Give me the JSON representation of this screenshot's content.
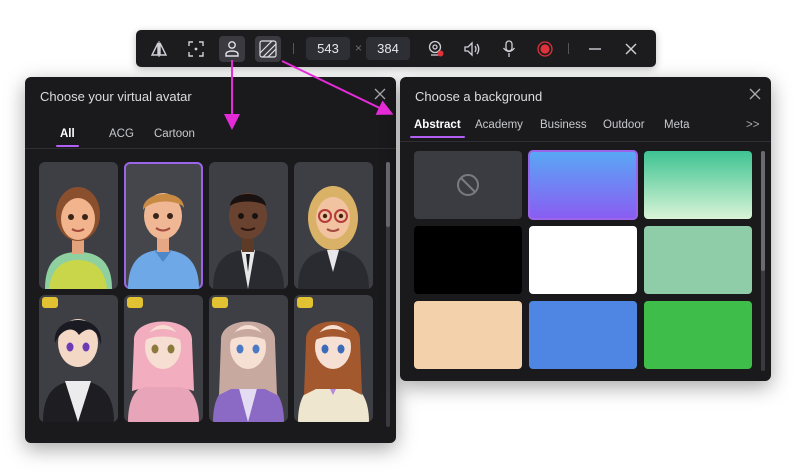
{
  "toolbar": {
    "width_value": "543",
    "height_value": "384",
    "times_symbol": "×"
  },
  "avatar_panel": {
    "title": "Choose your virtual avatar",
    "tabs": [
      {
        "label": "All"
      },
      {
        "label": "ACG"
      },
      {
        "label": "Cartoon"
      }
    ],
    "avatars": [
      {
        "name": "cartoon-woman",
        "premium": false
      },
      {
        "name": "cartoon-man-blonde",
        "premium": false,
        "selected": true
      },
      {
        "name": "cartoon-man-suit",
        "premium": false
      },
      {
        "name": "cartoon-woman-glasses",
        "premium": false
      },
      {
        "name": "anime-boy-dark-hair",
        "premium": true
      },
      {
        "name": "anime-girl-pink-hair",
        "premium": true
      },
      {
        "name": "anime-girl-purple-dress",
        "premium": true
      },
      {
        "name": "anime-girl-brown-hair",
        "premium": true
      }
    ]
  },
  "bg_panel": {
    "title": "Choose a background",
    "tabs": [
      {
        "label": "Abstract"
      },
      {
        "label": "Academy"
      },
      {
        "label": "Business"
      },
      {
        "label": "Outdoor"
      },
      {
        "label": "Meta"
      }
    ],
    "more_label": ">>",
    "swatches": [
      {
        "name": "none",
        "color": "#3b3c41"
      },
      {
        "name": "blue-purple-gradient",
        "color": "#6f72f7",
        "selected": true
      },
      {
        "name": "green-gradient",
        "color": "#63d39a"
      },
      {
        "name": "black",
        "color": "#000000"
      },
      {
        "name": "white",
        "color": "#ffffff"
      },
      {
        "name": "mint",
        "color": "#8fcca8"
      },
      {
        "name": "peach",
        "color": "#f3d1aa"
      },
      {
        "name": "blue",
        "color": "#4f86e3"
      },
      {
        "name": "green",
        "color": "#3fbd4a"
      }
    ]
  },
  "colors": {
    "accent": "#b15ff4",
    "arrow": "#e52bd8"
  }
}
